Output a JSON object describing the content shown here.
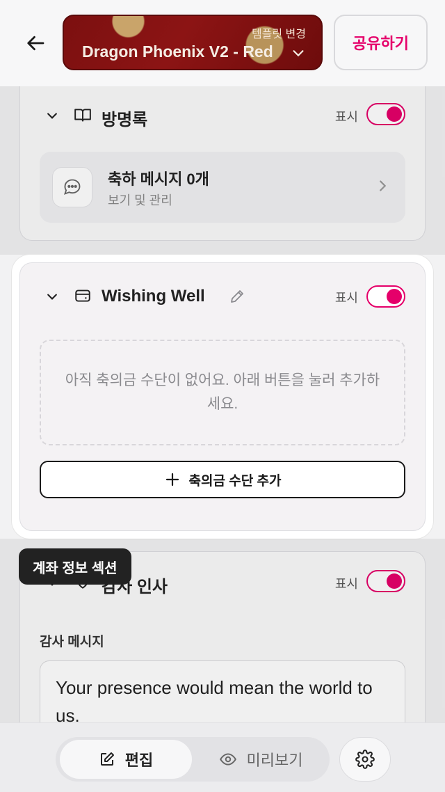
{
  "header": {
    "template_change_label": "템플릿 변경",
    "template_name": "Dragon Phoenix V2 - Red",
    "share_label": "공유하기"
  },
  "guestbook": {
    "title": "방명록",
    "show_label": "표시",
    "visible": true,
    "row_title": "축하 메시지 0개",
    "row_subtitle": "보기 및 관리"
  },
  "wishing_well": {
    "title": "Wishing Well",
    "show_label": "표시",
    "visible": true,
    "empty_text": "아직 축의금 수단이 없어요. 아래 버튼을 눌러 추가하세요.",
    "add_label": "축의금 수단 추가"
  },
  "tooltip": {
    "text": "계좌 정보 섹션"
  },
  "thanks": {
    "title": "감사 인사",
    "show_label": "표시",
    "visible": true,
    "message_label": "감사 메시지",
    "message_value": "Your presence would mean the world to us."
  },
  "bottom": {
    "edit_label": "편집",
    "preview_label": "미리보기"
  },
  "colors": {
    "accent": "#e5006a",
    "template_bg": "#7c1010"
  }
}
